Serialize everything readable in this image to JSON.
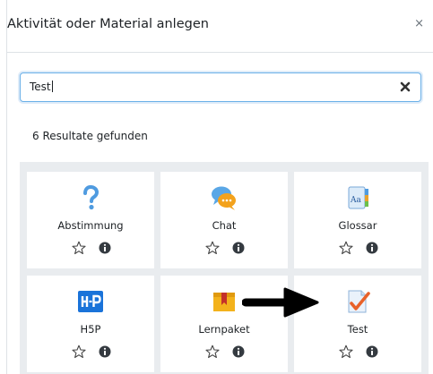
{
  "dialog": {
    "title": "Aktivität oder Material anlegen",
    "close_glyph": "×"
  },
  "search": {
    "value": "Test",
    "clear_icon": "times-icon"
  },
  "results_text": "6 Resultate gefunden",
  "cards": [
    {
      "label": "Abstimmung",
      "icon": "question-mark-icon"
    },
    {
      "label": "Chat",
      "icon": "chat-bubble-icon"
    },
    {
      "label": "Glossar",
      "icon": "glossary-book-icon"
    },
    {
      "label": "H5P",
      "icon": "h5p-logo-icon"
    },
    {
      "label": "Lernpaket",
      "icon": "package-box-icon"
    },
    {
      "label": "Test",
      "icon": "quiz-checkmark-icon"
    }
  ],
  "annotation": {
    "icon": "black-arrow-icon",
    "points_to": "Test"
  },
  "colors": {
    "grid_background": "#e9ecef",
    "search_focus": "#6ab0e8",
    "question_blue": "#4f9be0",
    "h5p_blue": "#1a73d9",
    "checkmark_orange": "#e8622a"
  }
}
